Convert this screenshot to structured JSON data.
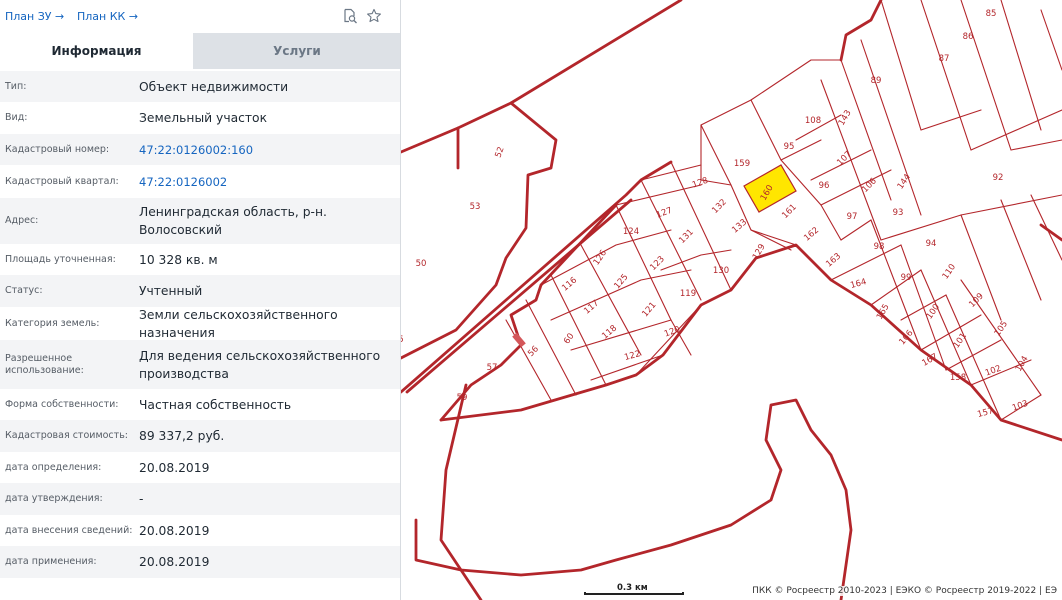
{
  "links": {
    "plan_zu": "План ЗУ →",
    "plan_kk": "План КК →"
  },
  "icons": {
    "search": "search-doc-icon",
    "favorite": "star-icon"
  },
  "tabs": [
    {
      "label": "Информация",
      "active": true
    },
    {
      "label": "Услуги",
      "active": false
    }
  ],
  "rows": [
    {
      "label": "Тип:",
      "value": "Объект недвижимости"
    },
    {
      "label": "Вид:",
      "value": "Земельный участок"
    },
    {
      "label": "Кадастровый номер:",
      "value": "47:22:0126002:160",
      "link": true
    },
    {
      "label": "Кадастровый квартал:",
      "value": "47:22:0126002",
      "link": true
    },
    {
      "label": "Адрес:",
      "value": "Ленинградская область, р-н. Волосовский"
    },
    {
      "label": "Площадь уточненная:",
      "value": "10 328 кв. м"
    },
    {
      "label": "Статус:",
      "value": "Учтенный"
    },
    {
      "label": "Категория земель:",
      "value": "Земли сельскохозяйственного назначения"
    },
    {
      "label": "Разрешенное использование:",
      "value": "Для ведения сельскохозяйственного производства"
    },
    {
      "label": "Форма собственности:",
      "value": "Частная собственность"
    },
    {
      "label": "Кадастровая стоимость:",
      "value": "89 337,2 руб."
    },
    {
      "label": "дата определения:",
      "value": "20.08.2019"
    },
    {
      "label": "дата утверждения:",
      "value": "-"
    },
    {
      "label": "дата внесения сведений:",
      "value": "20.08.2019"
    },
    {
      "label": "дата применения:",
      "value": "20.08.2019"
    }
  ],
  "map": {
    "colors": {
      "boundary": "#b3262b",
      "selected": "#ffe600"
    },
    "selected_plot": "160",
    "plot_labels": [
      "85",
      "86",
      "87",
      "89",
      "92",
      "108",
      "143",
      "95",
      "159",
      "160",
      "107",
      "106",
      "144",
      "96",
      "161",
      "97",
      "93",
      "162",
      "98",
      "94",
      "163",
      "99",
      "110",
      "164",
      "100",
      "109",
      "165",
      "105",
      "101",
      "166",
      "167",
      "104",
      "102",
      "158",
      "157",
      "103",
      "128",
      "127",
      "132",
      "133",
      "129",
      "124",
      "131",
      "130",
      "126",
      "123",
      "116",
      "125",
      "119",
      "117",
      "121",
      "118",
      "120",
      "122",
      "50",
      "53",
      "52",
      "56",
      "57",
      "59",
      "60",
      "5"
    ],
    "scale_label": "0.3 км",
    "copyright": "ПКК © Росреестр 2010-2023 | ЕЭКО © Росреестр 2019-2022 | ЕЭ"
  }
}
